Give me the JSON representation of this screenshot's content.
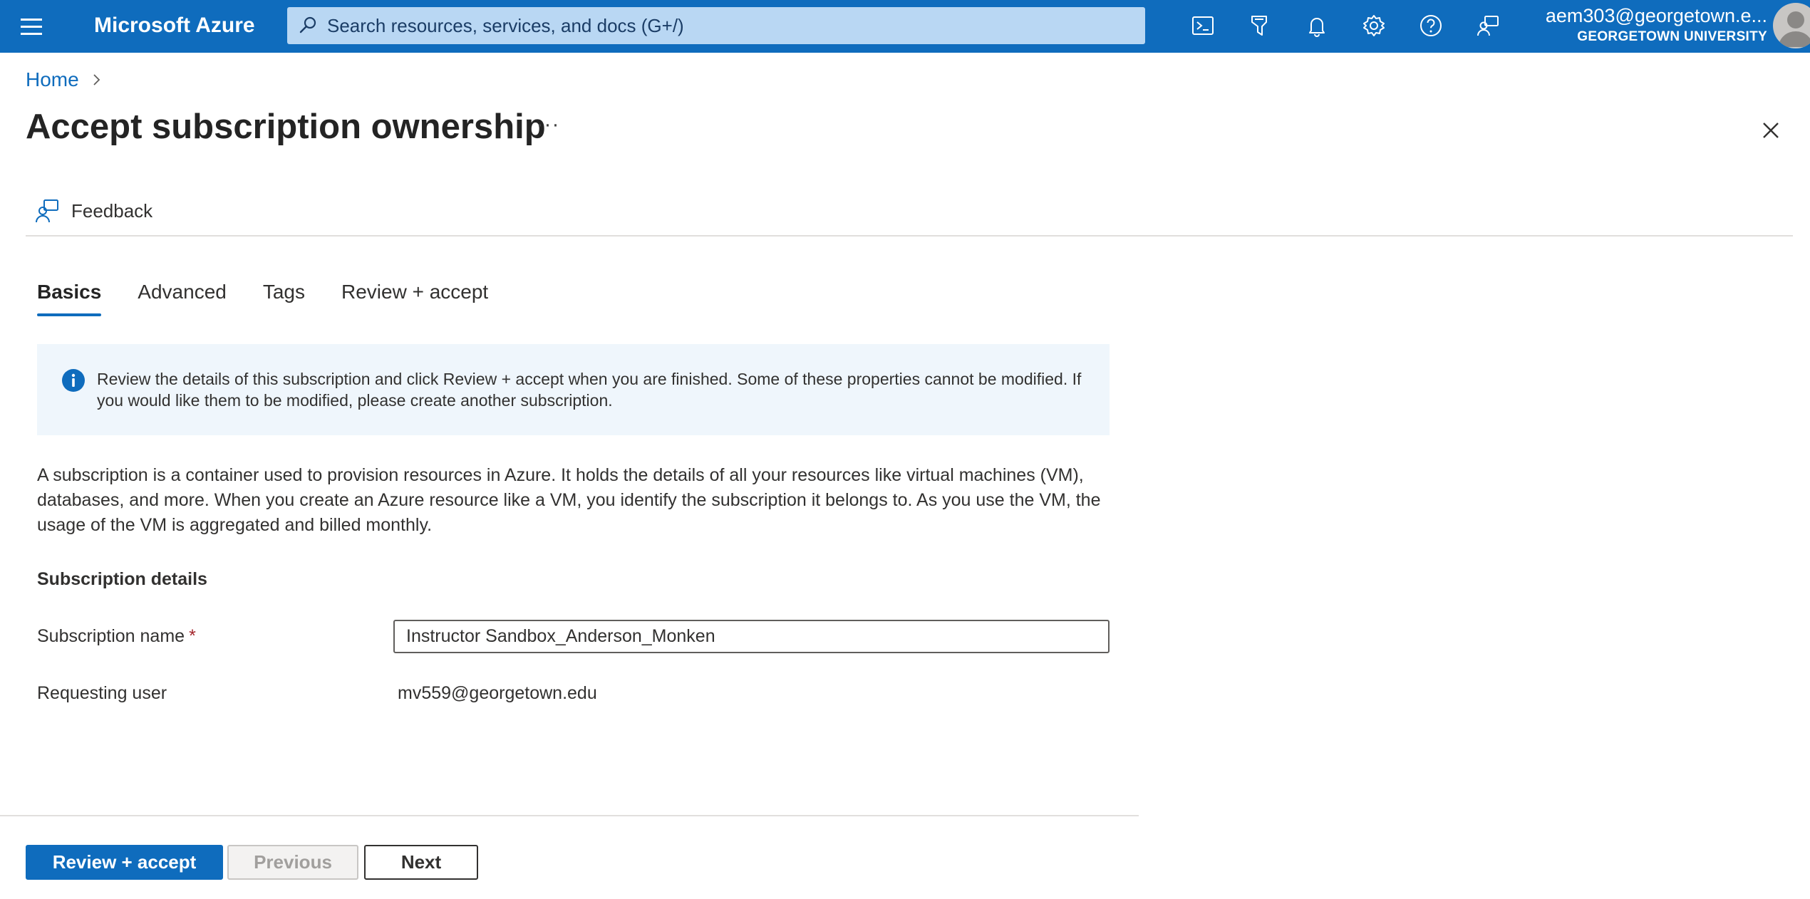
{
  "topbar": {
    "brand": "Microsoft Azure",
    "search_placeholder": "Search resources, services, and docs (G+/)",
    "icons": [
      "cloud-shell-icon",
      "directory-filter-icon",
      "notifications-icon",
      "settings-icon",
      "help-icon",
      "feedback-icon"
    ],
    "account_email": "aem303@georgetown.e...",
    "account_org": "GEORGETOWN UNIVERSITY"
  },
  "breadcrumb": {
    "home": "Home"
  },
  "page": {
    "title": "Accept subscription ownership",
    "more": "···"
  },
  "toolbar": {
    "feedback_label": "Feedback"
  },
  "tabs": [
    {
      "label": "Basics",
      "active": true
    },
    {
      "label": "Advanced",
      "active": false
    },
    {
      "label": "Tags",
      "active": false
    },
    {
      "label": "Review + accept",
      "active": false
    }
  ],
  "info": {
    "text": "Review the details of this subscription and click Review + accept when you are finished. Some of these properties cannot be modified. If you would like them to be modified, please create another subscription."
  },
  "description": "A subscription is a container used to provision resources in Azure. It holds the details of all your resources like virtual machines (VM), databases, and more. When you create an Azure resource like a VM, you identify the subscription it belongs to. As you use the VM, the usage of the VM is aggregated and billed monthly.",
  "details": {
    "heading": "Subscription details",
    "subscription_name_label": "Subscription name",
    "required_marker": "*",
    "subscription_name_value": "Instructor Sandbox_Anderson_Monken",
    "requesting_user_label": "Requesting user",
    "requesting_user_value": "mv559@georgetown.edu"
  },
  "footer": {
    "review_accept": "Review + accept",
    "previous": "Previous",
    "next": "Next"
  },
  "colors": {
    "brand_blue": "#0f6cbd",
    "search_bg": "#b9d7f3",
    "info_bg": "#eff6fc",
    "required": "#a4262c"
  }
}
